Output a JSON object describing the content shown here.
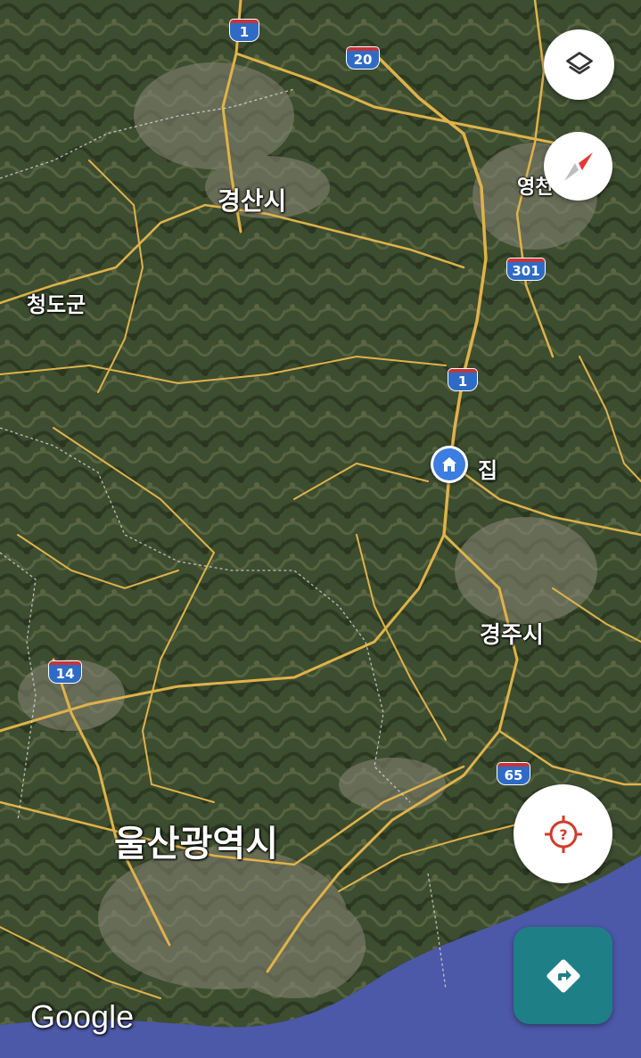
{
  "map": {
    "place_labels": {
      "gyeongsan": "경산시",
      "cheongdo": "청도군",
      "yeongcheon": "영천",
      "gyeongju": "경주시",
      "ulsan": "울산광역시",
      "home": "집"
    },
    "route_shields": {
      "r1_top": "1",
      "r20": "20",
      "r301": "301",
      "r1_mid": "1",
      "r14": "14",
      "r65": "65"
    },
    "attribution": "Google"
  },
  "controls": {
    "layers_icon": "layers-icon",
    "compass_icon": "compass-icon",
    "location_icon": "location-unknown-icon",
    "directions_icon": "directions-icon"
  },
  "colors": {
    "road": "#e0b24a",
    "sea": "#4c58a8",
    "shield": "#2f6bc4",
    "directions_button": "#1f7f87",
    "location_icon": "#d23a2a",
    "home_pin": "#3b7de0"
  }
}
